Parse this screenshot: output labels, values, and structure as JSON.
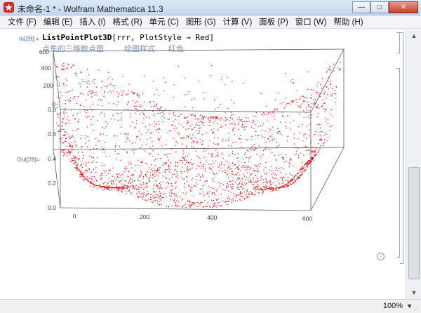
{
  "window": {
    "title": "未命名-1 * - Wolfram Mathematica 11.3",
    "minimize_glyph": "—",
    "maximize_glyph": "□",
    "close_glyph": "✕"
  },
  "menu": [
    "文件 (F)",
    "编辑 (E)",
    "插入 (I)",
    "格式 (R)",
    "单元 (C)",
    "图形 (G)",
    "计算 (V)",
    "面板 (P)",
    "窗口 (W)",
    "帮助 (H)"
  ],
  "cell": {
    "in_label": "In[28]:=",
    "code_fn": "ListPointPlot3D",
    "code_rest": "[rrr, PlotStyle → Red]",
    "annotations": [
      "点集的三维散点图",
      "绘图样式",
      "红色"
    ],
    "out_label": "Out[28]="
  },
  "plot": {
    "point_color": "#ff0000",
    "box_color": "#5a5a5a",
    "x_ticks": [
      "0",
      "200",
      "400",
      "600"
    ],
    "y_ticks": [
      "600",
      "400",
      "200",
      "0"
    ],
    "z_ticks": [
      "0.0",
      "0.2",
      "0.4",
      "0.6",
      "0.8"
    ]
  },
  "status": {
    "zoom": "100%"
  },
  "icons": {
    "app": "mathematica-spikey-icon",
    "nav": "arrow-right-circle-icon",
    "zoom_dropdown": "chevron-down-icon"
  }
}
